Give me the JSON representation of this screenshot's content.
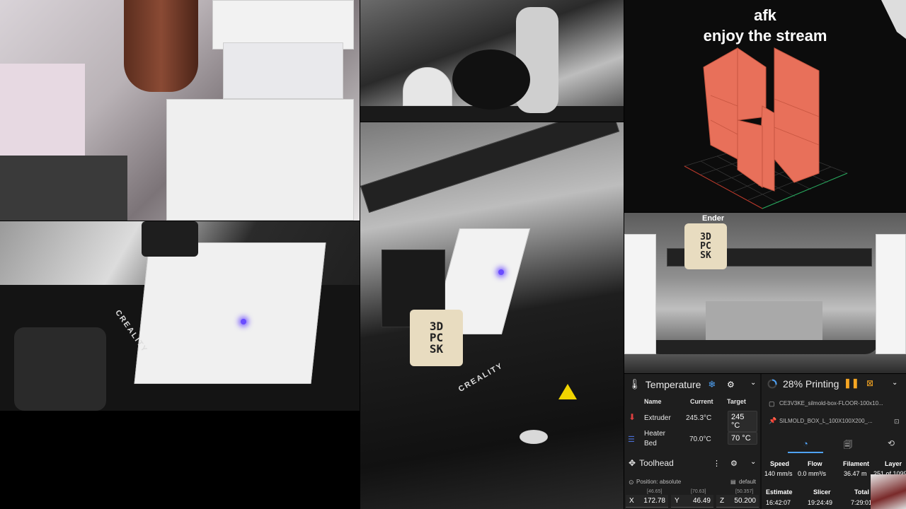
{
  "overlay": {
    "line1": "afk",
    "line2": "enjoy the stream"
  },
  "cameras": {
    "sticker_text": "3D\nPC\nSK",
    "bed_brand": "CREALITY",
    "printer_brand": "Ender"
  },
  "temperature": {
    "title": "Temperature",
    "col_name": "Name",
    "col_current": "Current",
    "col_target": "Target",
    "extruder": {
      "name": "Extruder",
      "current": "245.3°C",
      "target": "245 °C"
    },
    "heater_bed": {
      "name_line1": "Heater",
      "name_line2": "Bed",
      "current": "70.0°C",
      "target": "70 °C"
    }
  },
  "toolhead": {
    "title": "Toolhead",
    "position_label": "Position: absolute",
    "profile": "default",
    "x": {
      "label": "X",
      "value": "172.78",
      "commanded": "[46.65]"
    },
    "y": {
      "label": "Y",
      "value": "46.49",
      "commanded": "[70.63]"
    },
    "z": {
      "label": "Z",
      "value": "50.200",
      "commanded": "[50.357]"
    }
  },
  "printing": {
    "status": "28% Printing",
    "progress": 0.28,
    "file1": "CE3V3KE_silmold-box-FLOOR-100x10...",
    "file2": "SILMOLD_BOX_L_100X100X200_...",
    "stats": {
      "speed": {
        "label": "Speed",
        "value": "140 mm/s"
      },
      "flow": {
        "label": "Flow",
        "value": "0.0 mm³/s"
      },
      "filament": {
        "label": "Filament",
        "value": "36.47 m"
      },
      "layer": {
        "label": "Layer",
        "value": "251 of 1099"
      }
    },
    "times": {
      "estimate": {
        "label": "Estimate",
        "value": "16:42:07"
      },
      "slicer": {
        "label": "Slicer",
        "value": "19:24:49"
      },
      "total": {
        "label": "Total",
        "value": "7:29:01"
      }
    }
  },
  "colors": {
    "accent": "#4fa3f7",
    "pause": "#f5a623",
    "model": "#e8705a",
    "extruder_icon": "#e04040",
    "bed_icon": "#4a6fd6"
  }
}
